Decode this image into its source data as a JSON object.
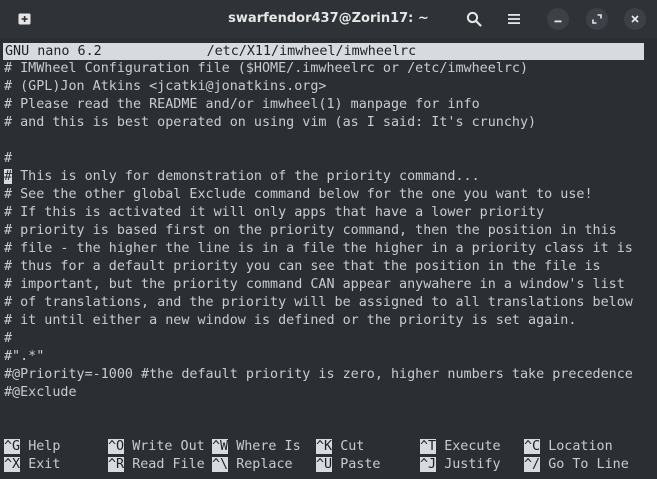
{
  "window": {
    "title": "swarfendor437@Zorin17: ~",
    "icons": [
      "new-tab-icon",
      "search-icon",
      "hamburger-menu-icon",
      "minimize-icon",
      "maximize-icon",
      "close-icon"
    ]
  },
  "nano": {
    "version": "GNU nano 6.2",
    "filename": "/etc/X11/imwheel/imwheelrc",
    "cursor_char": "#"
  },
  "lines": [
    "# IMWheel Configuration file ($HOME/.imwheelrc or /etc/imwheelrc)",
    "# (GPL)Jon Atkins <jcatki@jonatkins.org>",
    "# Please read the README and/or imwheel(1) manpage for info",
    "# and this is best operated on using vim (as I said: It's crunchy)",
    "",
    "#",
    " This is only for demonstration of the priority command...",
    "# See the other global Exclude command below for the one you want to use!",
    "# If this is activated it will only apps that have a lower priority",
    "# priority is based first on the priority command, then the position in this",
    "# file - the higher the line is in a file the higher in a priority class it is",
    "# thus for a default priority you can see that the position in the file is",
    "# important, but the priority command CAN appear anywahere in a window's list",
    "# of translations, and the priority will be assigned to all translations below",
    "# it until either a new window is defined or the priority is set again.",
    "#",
    "#\".*\"",
    "#@Priority=-1000 #the default priority is zero, higher numbers take precedence",
    "#@Exclude"
  ],
  "shortcuts": [
    {
      "key": "^G",
      "label": "Help"
    },
    {
      "key": "^O",
      "label": "Write Out"
    },
    {
      "key": "^W",
      "label": "Where Is"
    },
    {
      "key": "^K",
      "label": "Cut"
    },
    {
      "key": "^T",
      "label": "Execute"
    },
    {
      "key": "^C",
      "label": "Location"
    },
    {
      "key": "^X",
      "label": "Exit"
    },
    {
      "key": "^R",
      "label": "Read File"
    },
    {
      "key": "^\\",
      "label": "Replace"
    },
    {
      "key": "^U",
      "label": "Paste"
    },
    {
      "key": "^J",
      "label": "Justify"
    },
    {
      "key": "^/",
      "label": "Go To Line"
    }
  ]
}
